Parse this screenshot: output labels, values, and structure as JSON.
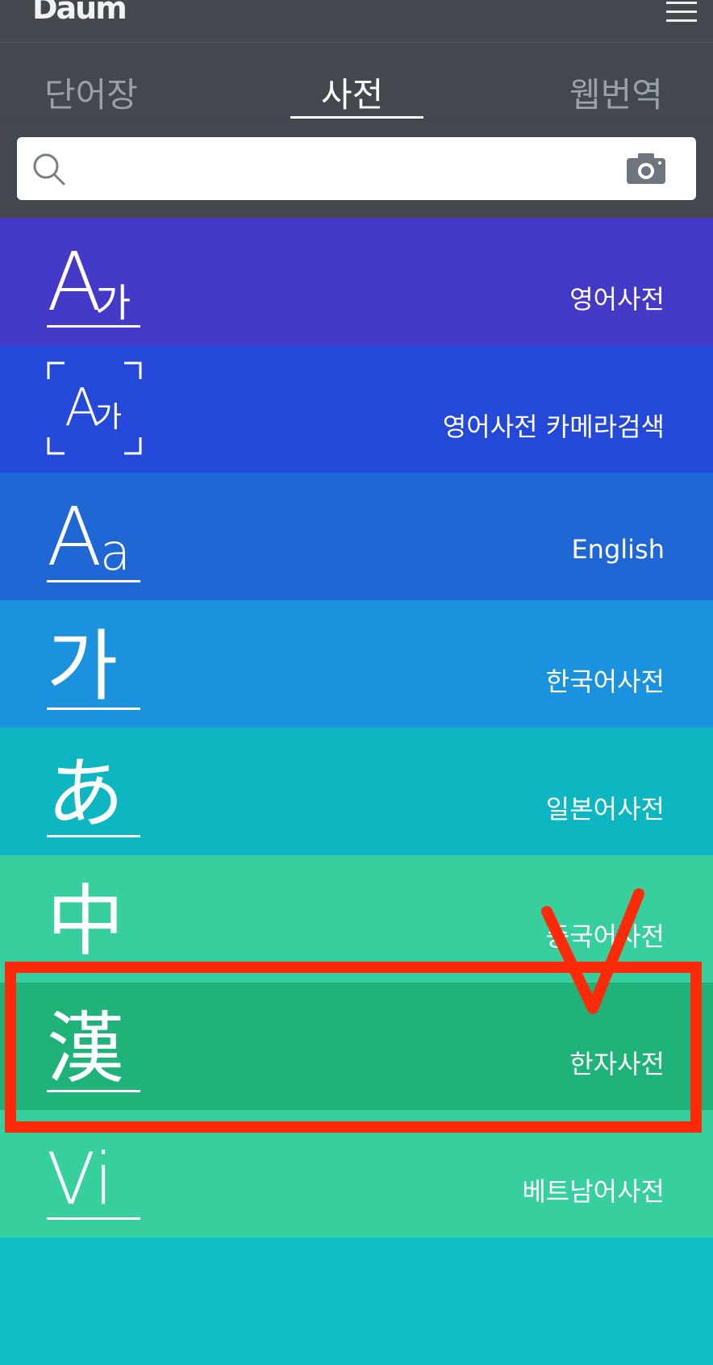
{
  "app": {
    "logo_text": "Daum"
  },
  "tabs": [
    {
      "label": "단어장"
    },
    {
      "label": "사전"
    },
    {
      "label": "웹번역"
    }
  ],
  "search": {
    "value": "",
    "placeholder": ""
  },
  "dictionaries": [
    {
      "label": "영어사전",
      "glyph_main": "A",
      "glyph_sub": "가",
      "color": "#4539c8"
    },
    {
      "label": "영어사전 카메라검색",
      "glyph_main": "A",
      "glyph_sub": "가",
      "color": "#2448d8"
    },
    {
      "label": "English",
      "glyph_main": "A",
      "glyph_sub": "a",
      "color": "#1f67d5"
    },
    {
      "label": "한국어사전",
      "glyph_main": "가",
      "glyph_sub": "",
      "color": "#1b92dd"
    },
    {
      "label": "일본어사전",
      "glyph_main": "あ",
      "glyph_sub": "",
      "color": "#0db7c2"
    },
    {
      "label": "중국어사전",
      "glyph_main": "中",
      "glyph_sub": "",
      "color": "#36cf9d"
    },
    {
      "label": "한자사전",
      "glyph_main": "漢",
      "glyph_sub": "",
      "color": "#1fb37a"
    },
    {
      "label": "베트남어사전",
      "glyph_main": "Vi",
      "glyph_sub": "",
      "color": "#36cf9d"
    },
    {
      "label": "",
      "glyph_main": "",
      "glyph_sub": "",
      "color": "#11bfc9"
    }
  ],
  "annotation": {
    "color": "#ff2a0a"
  }
}
